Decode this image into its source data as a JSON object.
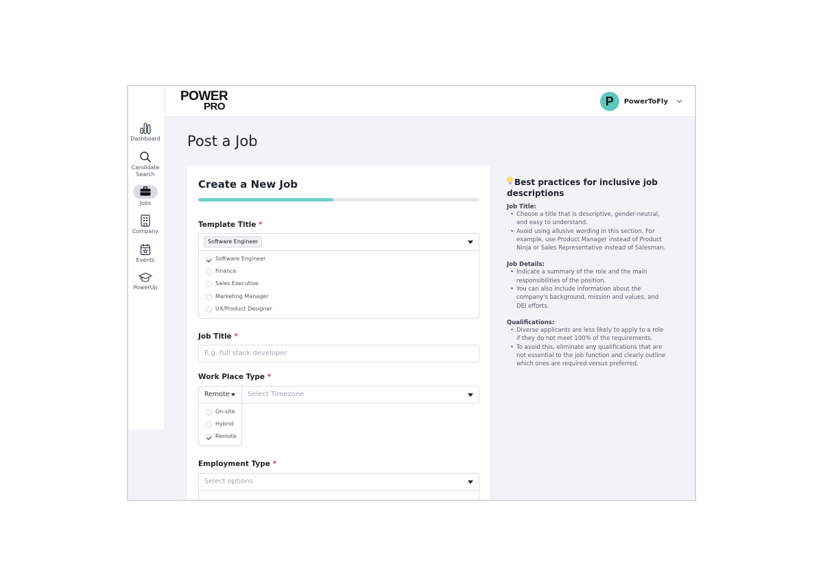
{
  "app": {
    "logo_line1": "POWER",
    "logo_line2": "PRO",
    "accent_color": "#6fd0c6"
  },
  "user": {
    "avatar_letter": "P",
    "name": "PowerToFly"
  },
  "sidebar": {
    "items": [
      {
        "label": "Dashboard",
        "icon": "bar-chart-icon"
      },
      {
        "label": "Candidate Search",
        "label_line1": "Candidate",
        "label_line2": "Search",
        "icon": "search-icon"
      },
      {
        "label": "Jobs",
        "icon": "briefcase-icon",
        "active": true
      },
      {
        "label": "Company",
        "icon": "building-icon"
      },
      {
        "label": "Events",
        "icon": "calendar-star-icon"
      },
      {
        "label": "PowerUp",
        "icon": "graduation-cap-icon"
      }
    ]
  },
  "page": {
    "title": "Post a Job"
  },
  "form": {
    "title": "Create a New Job",
    "progress_percent": 48,
    "template_title": {
      "label": "Template Title",
      "required_mark": "*",
      "selected": "Software Engineer",
      "options": [
        {
          "label": "Software Engineer",
          "checked": true
        },
        {
          "label": "Finance",
          "checked": false
        },
        {
          "label": "Sales Executive",
          "checked": false
        },
        {
          "label": "Marketing Manager",
          "checked": false
        },
        {
          "label": "UX/Product Designer",
          "checked": false
        }
      ]
    },
    "job_title": {
      "label": "Job Title",
      "required_mark": "*",
      "placeholder": "E.g. full stack developer",
      "value": ""
    },
    "work_place_type": {
      "label": "Work Place Type",
      "required_mark": "*",
      "selected": "Remote",
      "timezone_placeholder": "Select Timezone",
      "options": [
        {
          "label": "On-site",
          "checked": false
        },
        {
          "label": "Hybrid",
          "checked": false
        },
        {
          "label": "Remote",
          "checked": true
        }
      ]
    },
    "employment_type": {
      "label": "Employment Type",
      "required_mark": "*",
      "placeholder": "Select options"
    }
  },
  "tips": {
    "title": "Best practices for inclusive job descriptions",
    "sections": [
      {
        "heading": "Job Title:",
        "bullets": [
          "Choose a title that is descriptive, gender-neutral, and easy to understand.",
          "Avoid using allusive wording in this section. For example, use Product Manager instead of Product Ninja or Sales Representative instead of Salesman."
        ]
      },
      {
        "heading": "Job Details:",
        "bullets": [
          "Indicate a summary of the role and the main responsibilities of the position.",
          "You can also include information about the company's background, mission and values, and DEI efforts."
        ]
      },
      {
        "heading": "Qualifications:",
        "bullets": [
          "Diverse applicants are less likely to apply to a role if they do not meet 100% of the requirements.",
          "To avoid this, eliminate any qualifications that are not essential to the job function and clearly outline which ones are required versus preferred."
        ]
      }
    ]
  }
}
